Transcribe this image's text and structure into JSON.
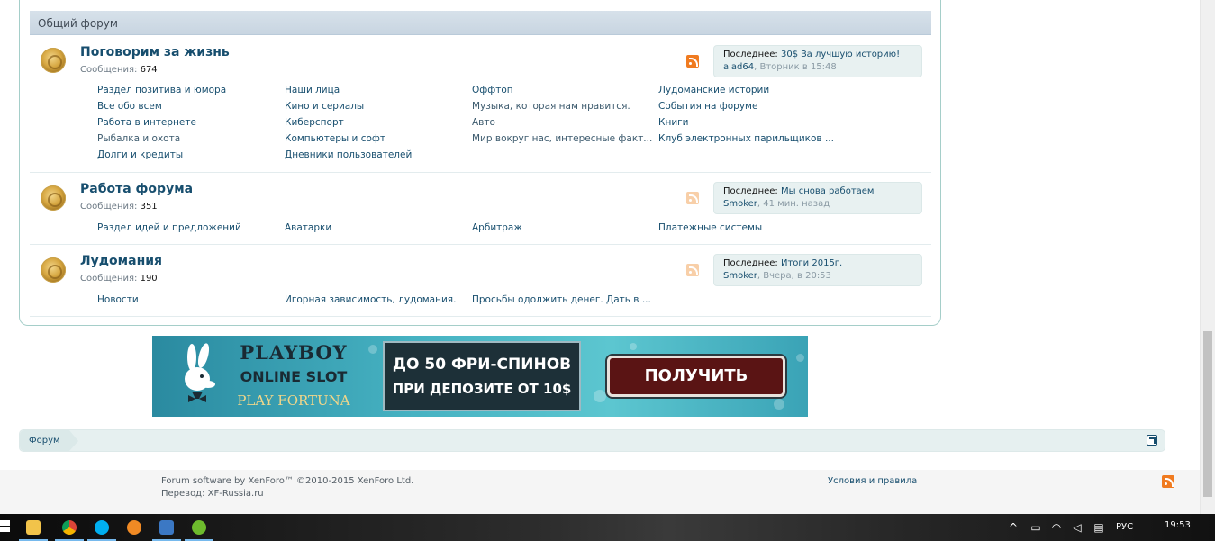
{
  "forum": {
    "category_title": "Общий форум",
    "nodes": [
      {
        "title": "Поговорим за жизнь",
        "stats_label": "Сообщения:",
        "stats_value": "674",
        "last_label": "Последнее:",
        "last_title": "30$ За лучшую историю!",
        "last_user": "alad64",
        "last_time": "Вторник в 15:48",
        "subforums": [
          "Раздел позитива и юмора",
          "Наши лица",
          "Оффтоп",
          "Лудоманские истории",
          "Все обо всем",
          "Кино и сериалы",
          "Музыка, которая нам нравится.",
          "События на форуме",
          "Работа в интернете",
          "Киберспорт",
          "Авто",
          "Книги",
          "Рыбалка и охота",
          "Компьютеры и софт",
          "Мир вокруг нас, интересные факт...",
          "Клуб электронных парильщиков ...",
          "Долги и кредиты",
          "Дневники пользователей"
        ]
      },
      {
        "title": "Работа форума",
        "stats_label": "Сообщения:",
        "stats_value": "351",
        "last_label": "Последнее:",
        "last_title": "Мы снова работаем",
        "last_user": "Smoker",
        "last_time": "41 мин. назад",
        "subforums": [
          "Раздел идей и предложений",
          "Аватарки",
          "Арбитраж",
          "Платежные системы"
        ]
      },
      {
        "title": "Лудомания",
        "stats_label": "Сообщения:",
        "stats_value": "190",
        "last_label": "Последнее:",
        "last_title": "Итоги 2015г.",
        "last_user": "Smoker",
        "last_time": "Вчера, в 20:53",
        "subforums": [
          "Новости",
          "Игорная зависимость, лудомания.",
          "Просьбы одолжить денег. Дать в ..."
        ]
      }
    ]
  },
  "banner": {
    "brand_line1": "PLAYBOY",
    "brand_line2": "ONLINE SLOT",
    "brand_line3": "PLAY FORTUNA",
    "offer_line1": "ДО 50 ФРИ-СПИНОВ",
    "offer_line2": "ПРИ ДЕПОЗИТЕ ОТ 10$",
    "cta": "ПОЛУЧИТЬ"
  },
  "breadcrumb": {
    "root": "Форум"
  },
  "footer": {
    "software": "Forum software by XenForo™ ©2010-2015 XenForo Ltd.",
    "translation": "Перевод: XF-Russia.ru",
    "terms": "Условия и правила"
  },
  "taskbar": {
    "apps": [
      "file-explorer-icon",
      "chrome-icon",
      "skype-icon",
      "app-orange-icon",
      "app-blue-icon",
      "utorrent-icon"
    ],
    "lang": "РУС",
    "time": "19:53"
  },
  "colors": {
    "link": "#174e6e",
    "category_bar": "#c8d5e1",
    "last_post_bg": "#e8f1f1",
    "rss": "#f07b20"
  }
}
